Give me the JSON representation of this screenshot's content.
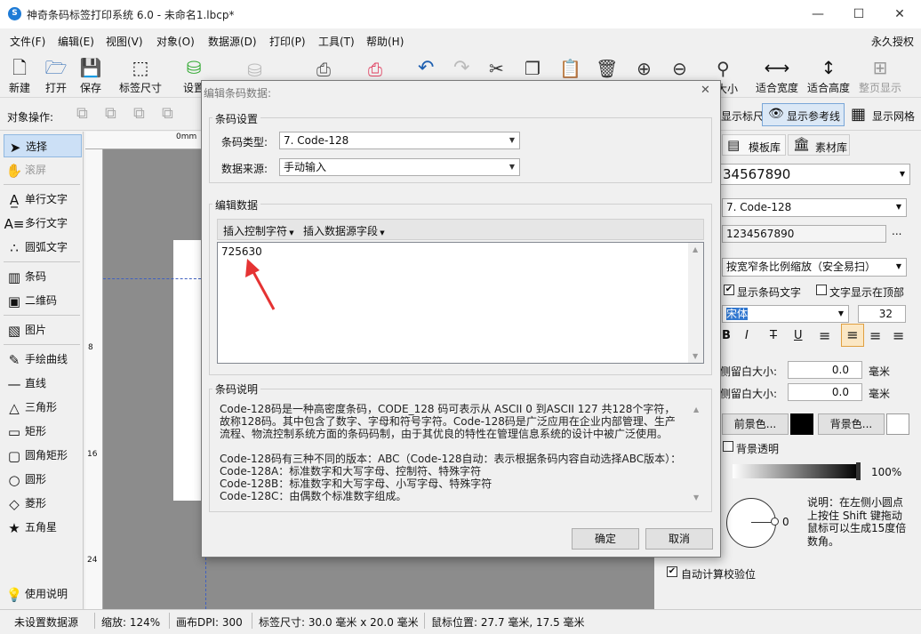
{
  "window": {
    "title": "神奇条码标签打印系统 6.0 - 未命名1.lbcp*",
    "app_icon": "S",
    "minimize": "—",
    "maximize": "☐",
    "close": "✕"
  },
  "menu": {
    "items": [
      "文件(F)",
      "编辑(E)",
      "视图(V)",
      "对象(O)",
      "数据源(D)",
      "打印(P)",
      "工具(T)",
      "帮助(H)"
    ],
    "license": "永久授权"
  },
  "toolbar": {
    "new": "新建",
    "open": "打开",
    "save": "保存",
    "label_size": "标签尺寸",
    "settings": "设置",
    "actual_size": "实际大小",
    "fit_width": "适合宽度",
    "fit_height": "适合高度",
    "full_page": "整页显示"
  },
  "toolbar2": {
    "object_ops": "对象操作:",
    "show_ruler": "显示标尺",
    "show_guides": "显示参考线",
    "show_grid": "显示网格"
  },
  "tools": {
    "select": "选择",
    "scroll": "滚屏",
    "single_text": "单行文字",
    "multi_text": "多行文字",
    "arc_text": "圆弧文字",
    "barcode": "条码",
    "qrcode": "二维码",
    "image": "图片",
    "freehand": "手绘曲线",
    "line": "直线",
    "triangle": "三角形",
    "rectangle": "矩形",
    "round_rect": "圆角矩形",
    "circle": "圆形",
    "diamond": "菱形",
    "star": "五角星",
    "help": "使用说明"
  },
  "ruler": {
    "h0": "0mm",
    "v8": "8",
    "v16": "16",
    "v24": "24"
  },
  "right_panel": {
    "tab_templates": "模板库",
    "tab_materials": "素材库",
    "barcode_value": "34567890",
    "barcode_type": "7. Code-128",
    "data_value": "1234567890",
    "more": "...",
    "scale_mode": "按宽窄条比例缩放（安全易扫）",
    "show_text": "显示条码文字",
    "text_top": "文字显示在顶部",
    "font": "宋体",
    "font_size": "32",
    "left_margin_label": "侧留白大小:",
    "left_margin": "0.0",
    "right_margin_label": "侧留白大小:",
    "right_margin": "0.0",
    "unit": "毫米",
    "fg_btn": "前景色...",
    "bg_btn": "背景色...",
    "transparent": "背景透明",
    "opacity": "100%",
    "rotation": "0",
    "rotation_note": "说明：在左侧小圆点上按住 Shift 键拖动鼠标可以生成15度倍数角。",
    "auto_check": "自动计算校验位"
  },
  "dialog": {
    "title": "编辑条码数据:",
    "close": "✕",
    "settings_group": "条码设置",
    "type_label": "条码类型:",
    "type_value": "7. Code-128",
    "source_label": "数据来源:",
    "source_value": "手动输入",
    "edit_group": "编辑数据",
    "insert_ctrl": "插入控制字符",
    "insert_field": "插入数据源字段",
    "data_value": "725630",
    "desc_group": "条码说明",
    "desc_p1": "Code-128码是一种高密度条码，CODE_128 码可表示从 ASCII 0 到ASCII 127 共128个字符，故称128码。其中包含了数字、字母和符号字符。Code-128码是广泛应用在企业内部管理、生产流程、物流控制系统方面的条码码制，由于其优良的特性在管理信息系统的设计中被广泛使用。",
    "desc_l1": "Code-128码有三种不同的版本：ABC（Code-128自动：表示根据条码内容自动选择ABC版本）：",
    "desc_l2": "Code-128A：标准数字和大写字母、控制符、特殊字符",
    "desc_l3": "Code-128B：标准数字和大写字母、小写字母、特殊字符",
    "desc_l4": "Code-128C：由偶数个标准数字组成。",
    "ok": "确定",
    "cancel": "取消"
  },
  "status": {
    "source": "未设置数据源",
    "zoom": "缩放: 124%",
    "dpi": "画布DPI: 300",
    "label_size": "标签尺寸: 30.0 毫米 x 20.0 毫米",
    "mouse": "鼠标位置: 27.7 毫米, 17.5 毫米"
  },
  "colors": {
    "accent": "#1e7bd6",
    "annotation_arrow": "#e53333",
    "foreground_swatch": "#000000",
    "background_swatch": "#ffffff"
  }
}
